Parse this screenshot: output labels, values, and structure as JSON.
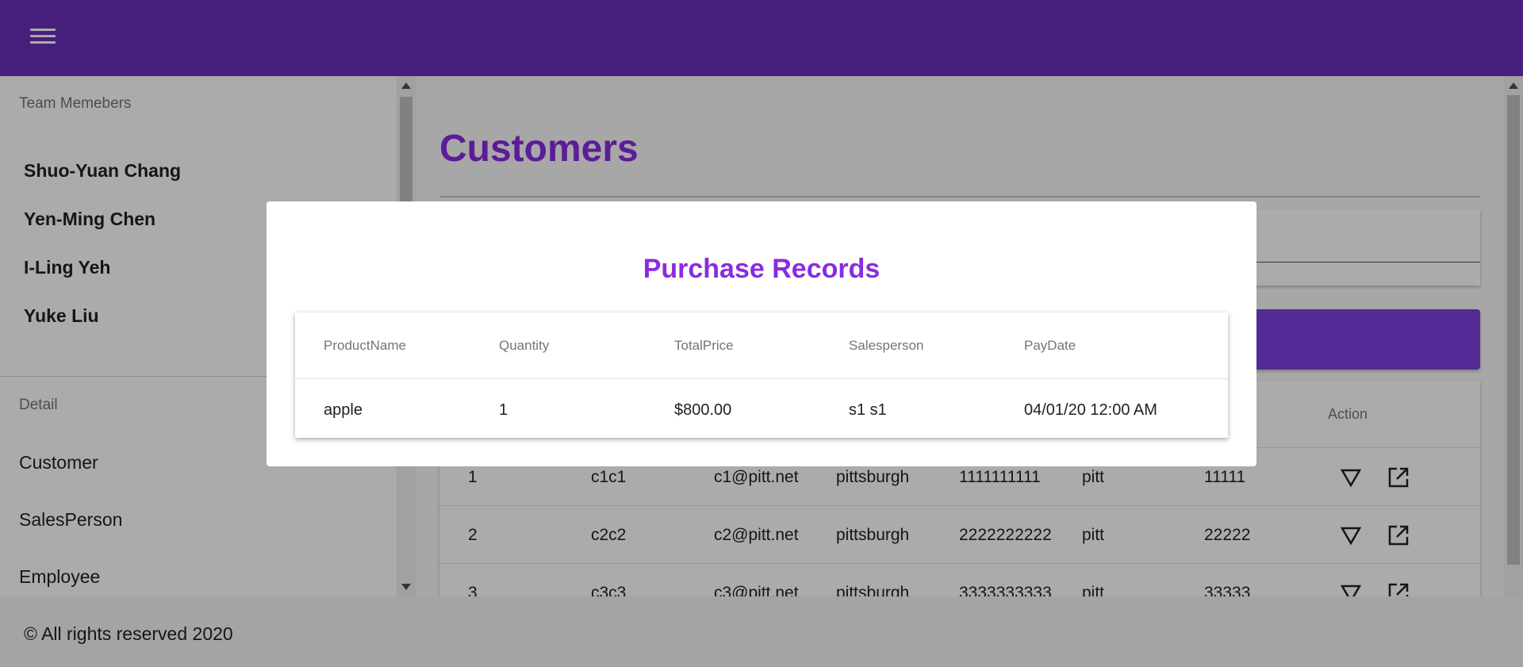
{
  "colors": {
    "app_bar": "#6a2fb9",
    "accent": "#8a2be2",
    "button": "#7c3fe0"
  },
  "sidebar": {
    "team_title": "Team Memebers",
    "members": [
      "Shuo-Yuan Chang",
      "Yen-Ming Chen",
      "I-Ling Yeh",
      "Yuke Liu"
    ],
    "detail_title": "Detail",
    "nav": [
      "Customer",
      "SalesPerson",
      "Employee"
    ]
  },
  "main": {
    "title": "Customers",
    "table": {
      "action_header": "Action",
      "rows": [
        {
          "id": "1",
          "name": "c1c1",
          "email": "c1@pitt.net",
          "city": "pittsburgh",
          "phone": "1111111111",
          "street": "pitt",
          "zip": "11111"
        },
        {
          "id": "2",
          "name": "c2c2",
          "email": "c2@pitt.net",
          "city": "pittsburgh",
          "phone": "2222222222",
          "street": "pitt",
          "zip": "22222"
        },
        {
          "id": "3",
          "name": "c3c3",
          "email": "c3@pitt.net",
          "city": "pittsburgh",
          "phone": "3333333333",
          "street": "pitt",
          "zip": "33333"
        }
      ]
    }
  },
  "footer": {
    "text": "© All rights reserved 2020"
  },
  "modal": {
    "title": "Purchase Records",
    "headers": [
      "ProductName",
      "Quantity",
      "TotalPrice",
      "Salesperson",
      "PayDate"
    ],
    "rows": [
      {
        "product": "apple",
        "quantity": "1",
        "total": "$800.00",
        "salesperson": "s1 s1",
        "paydate": "04/01/20 12:00 AM"
      }
    ]
  }
}
